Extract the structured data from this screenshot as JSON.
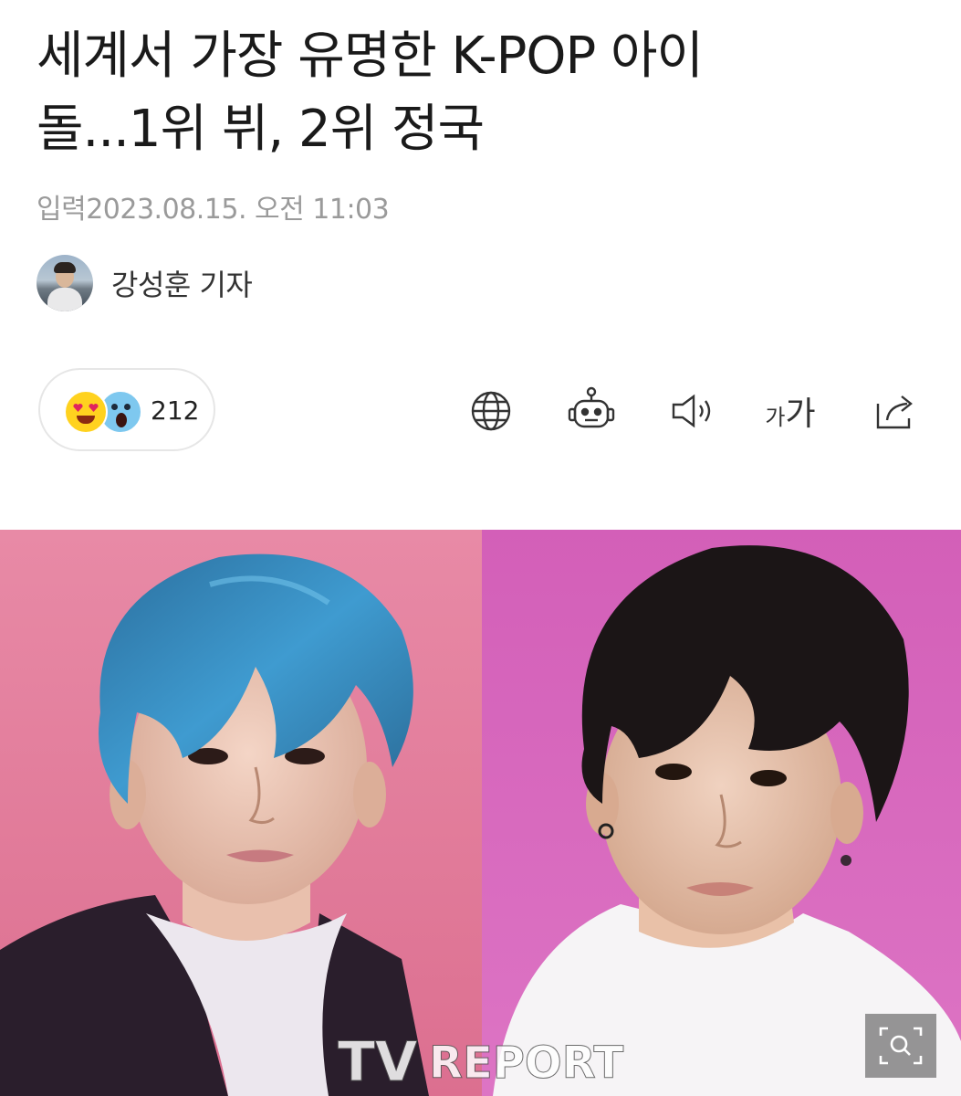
{
  "article": {
    "headline_line1": "세계서 가장 유명한 K-POP 아이",
    "headline_line2": "돌...1위 뷔, 2위 정국",
    "date_label": "입력",
    "date_value": "2023.08.15. 오전 11:03",
    "reporter": "강성훈 기자"
  },
  "reactions": {
    "emojis": [
      "heart-eyes-emoji",
      "surprised-emoji"
    ],
    "count": "212"
  },
  "toolbar": {
    "icons": [
      "globe-icon",
      "robot-icon",
      "speaker-icon",
      "font-size-icon",
      "share-icon"
    ],
    "font_small": "가",
    "font_large": "가"
  },
  "photo": {
    "watermark_tv": "TV",
    "watermark_report": "REPORT",
    "colors": {
      "left_bg": "#e27fa0",
      "right_bg": "#d86ac0",
      "hair_blue": "#3d8fc4",
      "hair_dark": "#1a1414"
    }
  }
}
